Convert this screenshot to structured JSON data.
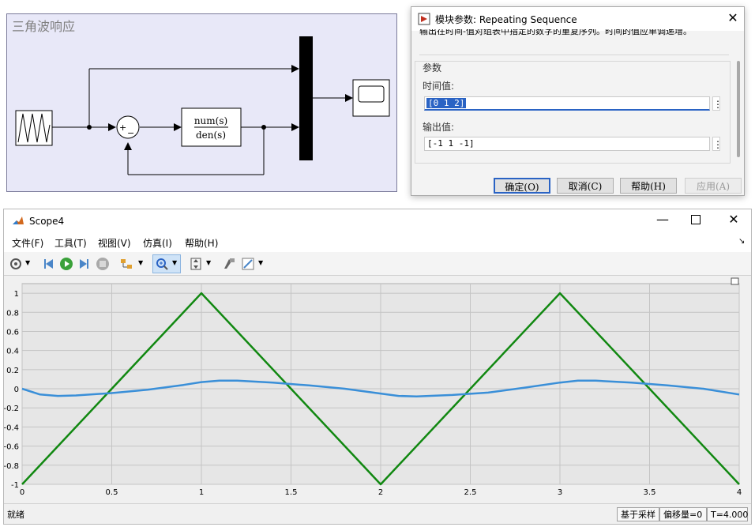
{
  "model": {
    "title": "三角波响应",
    "block_tf_num": "num(s)",
    "block_tf_den": "den(s)",
    "sum_plus": "+",
    "sum_minus": "−"
  },
  "dialog": {
    "title": "模块参数: Repeating Sequence",
    "description": "输出在时间-值对组表中指定的数字的重复序列。时间的值应单调递增。",
    "section": "参数",
    "time_label": "时间值:",
    "time_value": "[0 1 2]",
    "output_label": "输出值:",
    "output_value": "[-1 1 -1]",
    "buttons": {
      "ok": "确定(O)",
      "cancel": "取消(C)",
      "help": "帮助(H)",
      "apply": "应用(A)"
    }
  },
  "scope": {
    "title": "Scope4",
    "menu": [
      "文件(F)",
      "工具(T)",
      "视图(V)",
      "仿真(I)",
      "帮助(H)"
    ],
    "toolbar_icons": [
      "gear-icon",
      "step-back-icon",
      "run-icon",
      "step-forward-icon",
      "stop-icon",
      "signal-select-icon",
      "zoom-in-icon",
      "fit-axes-icon",
      "highlight-icon",
      "style-icon"
    ],
    "status": {
      "left": "就绪",
      "sample": "基于采样",
      "offset": "偏移量=0",
      "time": "T=4.000"
    },
    "colors": {
      "triangle": "#118811",
      "response": "#3a8fd8",
      "plot_bg": "#e6e6e6"
    }
  },
  "chart_data": {
    "type": "line",
    "xlim": [
      0,
      4
    ],
    "ylim": [
      -1,
      1.1
    ],
    "xticks": [
      0,
      0.5,
      1,
      1.5,
      2,
      2.5,
      3,
      3.5,
      4
    ],
    "xtick_labels": [
      "0",
      "0.5",
      "1",
      "1.5",
      "2",
      "2.5",
      "3",
      "3.5",
      "4"
    ],
    "yticks": [
      -1,
      -0.8,
      -0.6,
      -0.4,
      -0.2,
      0,
      0.2,
      0.4,
      0.6,
      0.8,
      1
    ],
    "ytick_labels": [
      "-1",
      "-0.8",
      "-0.6",
      "-0.4",
      "-0.2",
      "0",
      "0.2",
      "0.4",
      "0.6",
      "0.8",
      "1"
    ],
    "grid": true,
    "series": [
      {
        "x": [
          0,
          1,
          2,
          3,
          4
        ],
        "y": [
          -1,
          1,
          -1,
          1,
          -1
        ]
      },
      {
        "x": [
          0,
          0.1,
          0.2,
          0.3,
          0.5,
          0.7,
          0.9,
          1.0,
          1.1,
          1.2,
          1.4,
          1.6,
          1.8,
          2.0,
          2.1,
          2.2,
          2.4,
          2.6,
          2.8,
          3.0,
          3.1,
          3.2,
          3.4,
          3.6,
          3.8,
          4.0
        ],
        "y": [
          0,
          -0.06,
          -0.075,
          -0.07,
          -0.045,
          -0.01,
          0.04,
          0.07,
          0.085,
          0.085,
          0.065,
          0.035,
          0.0,
          -0.05,
          -0.075,
          -0.08,
          -0.065,
          -0.04,
          0.01,
          0.065,
          0.085,
          0.085,
          0.065,
          0.035,
          0.0,
          -0.06
        ]
      }
    ]
  }
}
